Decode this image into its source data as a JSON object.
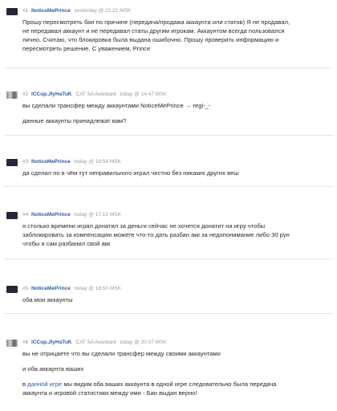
{
  "posts": [
    {
      "number": "#1",
      "author": "NoticeMePrince",
      "role": "",
      "time": "yesterday @ 22:22 MSK",
      "lines": [
        "Прошу пересмотреть бан по причине (передача/продажа аккаунта или статов) Я не продавал,",
        "не передавал аккаунт и не передавал статы другим игрокам. Аккаунтом всегда пользовался",
        "лично. Считаю, что блокировка была выдана ошибочно. Прошу проверить информацию и",
        "пересмотреть решение. С уважением, Prince"
      ]
    },
    {
      "number": "#2",
      "author": "ICCup.JlyHaTuK",
      "role": "CAT SA Assistant",
      "time": "today @ 14:47 MSK",
      "paragraphs": [
        "вы сделали трансфер между аккаунтами NoticeMePrince → regi-_-",
        "данные аккаунты принадлежат вам?"
      ]
    },
    {
      "number": "#3",
      "author": "NoticeMePrince",
      "role": "",
      "time": "today @ 16:58 MSK",
      "lines": [
        "да сделал но в чём тут неправильного играл честно без никаких других веш"
      ]
    },
    {
      "number": "#4",
      "author": "NoticeMePrince",
      "role": "",
      "time": "today @ 17:15 MSK",
      "lines": [
        "я столько времени играл донатил за деньги сейчас не хочется донатит на игру чтобы",
        "заблокировать за компенсацию можете что-то дать разбан акк за недопонимание либо 30 рун",
        "чтобы я сам разбанил свой акк"
      ]
    },
    {
      "number": "#5",
      "author": "NoticeMePrince",
      "role": "",
      "time": "today @ 18:50 MSK",
      "lines": [
        "оба мои аккаунты"
      ]
    },
    {
      "number": "#6",
      "author": "ICCup.JlyHaTuK",
      "role": "CAT SA Assistant",
      "time": "today @ 20:37 MSK",
      "p1": "вы не отрицаете что вы сделали трансфер между своими аккаунтами",
      "p2": "и оба аккаунта ваших",
      "p3_prefix": "в ",
      "p3_link": "данной игре",
      "p3_rest": " мы видим оба ваших аккаунта в одной игре следовательно была передача",
      "p3_line2": "аккаунта и игровой статистики между ими - Бан выдан верно!"
    }
  ]
}
